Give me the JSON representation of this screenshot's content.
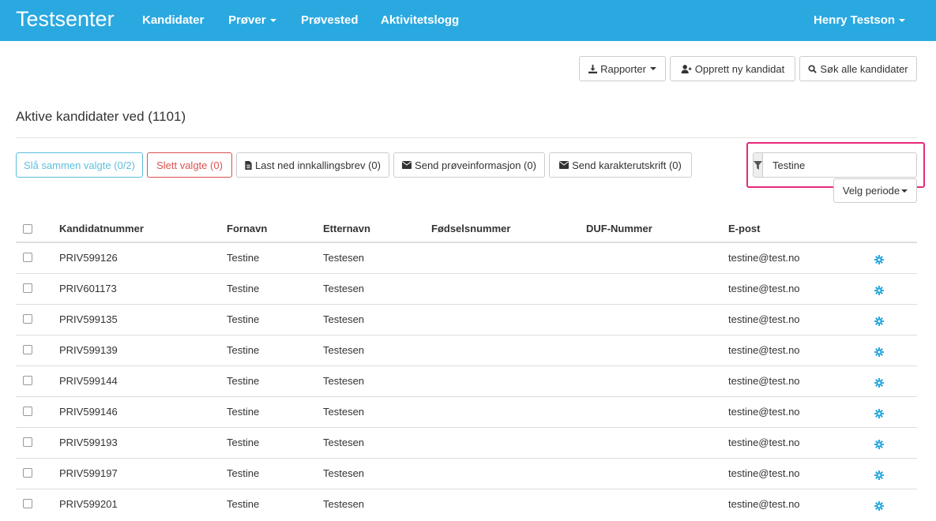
{
  "navbar": {
    "brand": "Testsenter",
    "items": [
      {
        "label": "Kandidater"
      },
      {
        "label": "Prøver"
      },
      {
        "label": "Prøvested"
      },
      {
        "label": "Aktivitetslogg"
      }
    ],
    "user": "Henry Testson"
  },
  "toolbar": {
    "rapporter": "Rapporter",
    "opprett": "Opprett ny kandidat",
    "sok": "Søk alle kandidater"
  },
  "page_title": "Aktive kandidater ved (1101)",
  "actions": {
    "merge": "Slå sammen valgte (0/2)",
    "delete": "Slett valgte (0)",
    "download": "Last ned innkallingsbrev (0)",
    "send_info": "Send prøveinformasjon (0)",
    "send_grades": "Send karakterutskrift (0)"
  },
  "filter": {
    "value": "Testine"
  },
  "period": "Velg periode",
  "table": {
    "headers": [
      "Kandidatnummer",
      "Fornavn",
      "Etternavn",
      "Fødselsnummer",
      "DUF-Nummer",
      "E-post"
    ],
    "rows": [
      {
        "id": "PRIV599126",
        "first": "Testine",
        "last": "Testesen",
        "email": "testine@test.no"
      },
      {
        "id": "PRIV601173",
        "first": "Testine",
        "last": "Testesen",
        "email": "testine@test.no"
      },
      {
        "id": "PRIV599135",
        "first": "Testine",
        "last": "Testesen",
        "email": "testine@test.no"
      },
      {
        "id": "PRIV599139",
        "first": "Testine",
        "last": "Testesen",
        "email": "testine@test.no"
      },
      {
        "id": "PRIV599144",
        "first": "Testine",
        "last": "Testesen",
        "email": "testine@test.no"
      },
      {
        "id": "PRIV599146",
        "first": "Testine",
        "last": "Testesen",
        "email": "testine@test.no"
      },
      {
        "id": "PRIV599193",
        "first": "Testine",
        "last": "Testesen",
        "email": "testine@test.no"
      },
      {
        "id": "PRIV599197",
        "first": "Testine",
        "last": "Testesen",
        "email": "testine@test.no"
      },
      {
        "id": "PRIV599201",
        "first": "Testine",
        "last": "Testesen",
        "email": "testine@test.no"
      }
    ]
  },
  "colors": {
    "navbar": "#2aa9e0",
    "gear": "#2aa9e0",
    "highlight": "#e8297a",
    "danger": "#d9534f",
    "info": "#5bc0de"
  }
}
